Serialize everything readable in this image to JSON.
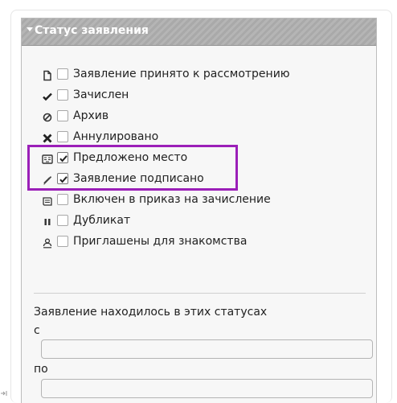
{
  "panel": {
    "title": "Статус заявления",
    "toggle_icon": "triangle-down-icon",
    "statuses": [
      {
        "icon": "document-icon",
        "label": "Заявление принято к рассмотрению",
        "checked": false
      },
      {
        "icon": "checkmark-icon",
        "label": "Зачислен",
        "checked": false
      },
      {
        "icon": "prohibited-icon",
        "label": "Архив",
        "checked": false
      },
      {
        "icon": "cross-icon",
        "label": "Аннулировано",
        "checked": false
      },
      {
        "icon": "vacancy-card-icon",
        "label": "Предложено место",
        "checked": true
      },
      {
        "icon": "pen-icon",
        "label": "Заявление подписано",
        "checked": true
      },
      {
        "icon": "order-sheet-icon",
        "label": "Включен в приказ на зачисление",
        "checked": false
      },
      {
        "icon": "duplicate-icon",
        "label": "Дубликат",
        "checked": false
      },
      {
        "icon": "person-icon",
        "label": "Приглашены для знакомства",
        "checked": false
      }
    ],
    "history": {
      "title": "Заявление находилось в этих статусах",
      "from_label": "с",
      "from_value": "",
      "to_label": "по",
      "to_value": ""
    }
  },
  "highlight_color": "#9b1fb8"
}
